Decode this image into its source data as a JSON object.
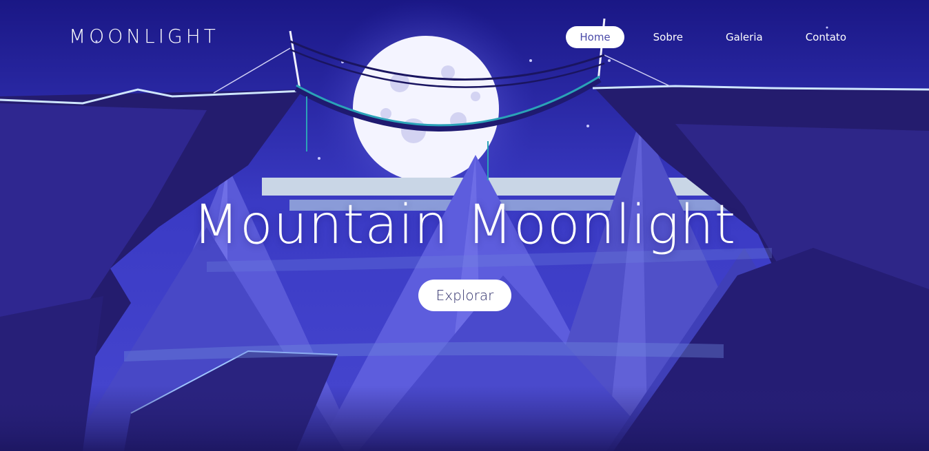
{
  "brand": {
    "logo": "MOONLIGHT"
  },
  "nav": {
    "items": [
      {
        "label": "Home",
        "active": true
      },
      {
        "label": "Sobre",
        "active": false
      },
      {
        "label": "Galeria",
        "active": false
      },
      {
        "label": "Contato",
        "active": false
      }
    ]
  },
  "hero": {
    "title": "Mountain Moonlight",
    "cta_label": "Explorar"
  },
  "colors": {
    "sky_top": "#1c1a8a",
    "sky_mid": "#3f3fc8",
    "moon": "#f4f4ff",
    "mountain_light": "#6a6ae6",
    "mountain_dark": "#2a237f",
    "cliff_dark": "#241c6e",
    "accent_cyan": "#2ba3b8"
  }
}
